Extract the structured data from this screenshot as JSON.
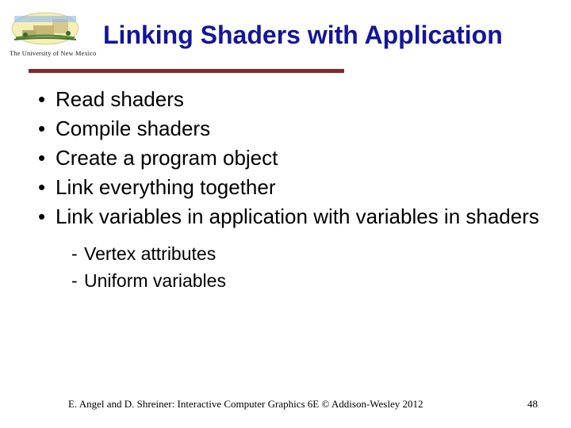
{
  "logo_caption": "The University of New Mexico",
  "title": "Linking Shaders with Application",
  "bullets": [
    "Read shaders",
    "Compile shaders",
    "Create a program object",
    "Link everything together",
    "Link variables in application with variables in shaders"
  ],
  "subbullets": [
    "Vertex attributes",
    "Uniform variables"
  ],
  "footer": "E. Angel and D. Shreiner: Interactive Computer Graphics 6E © Addison-Wesley 2012",
  "page_number": "48",
  "colors": {
    "title": "#141599",
    "underline": "#862628"
  }
}
